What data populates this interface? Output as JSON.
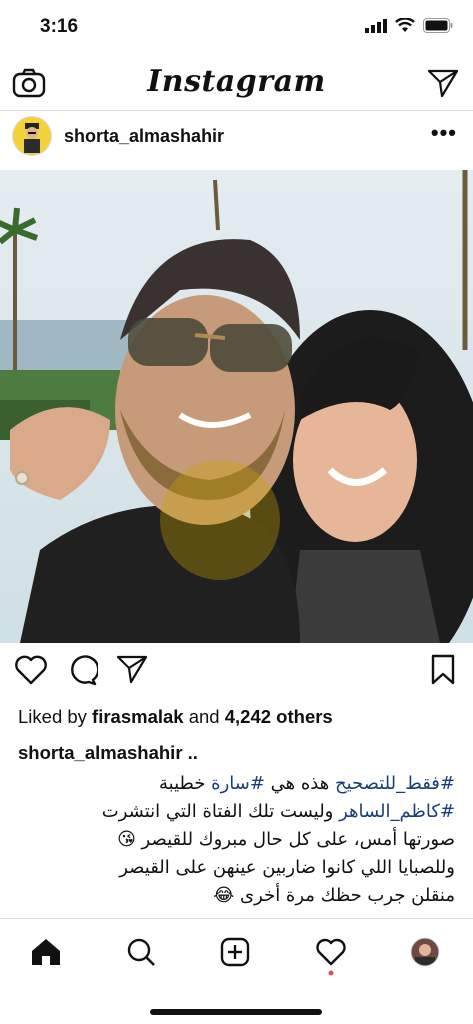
{
  "status": {
    "time": "3:16"
  },
  "nav": {
    "title": "Instagram"
  },
  "post": {
    "username": "shorta_almashahir",
    "more": "•••",
    "likes": {
      "prefix": "Liked by ",
      "user": "firasmalak",
      "middle": " and ",
      "count": "4,242 others"
    },
    "caption_user": "shorta_almashahir ..",
    "caption_lines": [
      {
        "tag": "#فقط_للتصحيح",
        "text": " هذه هي ",
        "tag2": "#سارة",
        "text2": " خطيبة"
      },
      {
        "tag": "#كاظم_الساهر",
        "text": " وليست تلك الفتاة التي انتشرت"
      },
      {
        "text": "صورتها أمس، على كل حال مبروك للقيصر 😘"
      },
      {
        "text": "وللصبايا اللي كانوا ضاربين عينهن على القيصر"
      },
      {
        "text": "منقلن جرب حظك مرة أخرى 😂"
      }
    ]
  },
  "icons": {
    "camera": "camera-icon",
    "send": "direct-message-icon",
    "heart": "heart-icon",
    "comment": "comment-icon",
    "share": "share-icon",
    "bookmark": "bookmark-icon",
    "home": "home-icon",
    "search": "search-icon",
    "add": "add-post-icon",
    "activity": "activity-icon",
    "profile": "profile-avatar"
  },
  "colors": {
    "hashtag": "#1a3d7a",
    "notification_dot": "#ed4956"
  }
}
